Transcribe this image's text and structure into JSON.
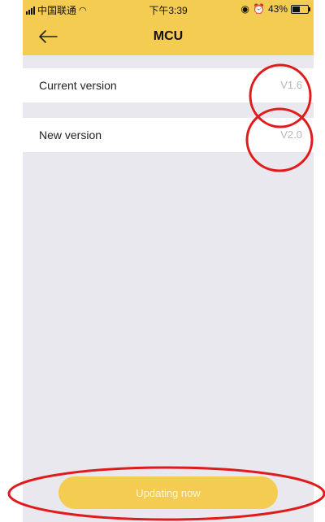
{
  "status_bar": {
    "carrier": "中国联通",
    "time": "下午3:39",
    "battery": "43%"
  },
  "header": {
    "title": "MCU"
  },
  "versions": {
    "current_label": "Current version",
    "current_value": "V1.6",
    "new_label": "New version",
    "new_value": "V2.0"
  },
  "footer": {
    "update_button_label": "Updating now"
  },
  "colors": {
    "accent": "#f4cc52",
    "background": "#e9e8ee",
    "annotation": "#e01b1b"
  },
  "icons": {
    "back": "arrow-left-icon",
    "wifi": "wifi-icon",
    "signal": "signal-icon",
    "battery": "battery-icon",
    "alarm": "alarm-icon",
    "location": "location-lock-icon"
  }
}
